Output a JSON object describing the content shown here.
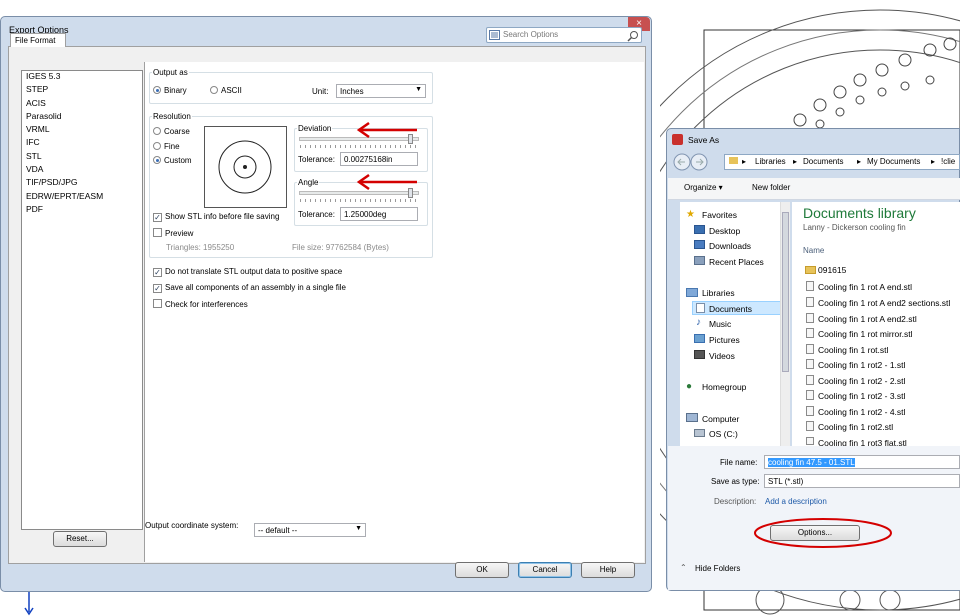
{
  "export_window": {
    "title": "Export Options",
    "close_glyph": "×",
    "tab": "File Format",
    "search_placeholder": "Search Options",
    "formats": [
      "IGES 5.3",
      "STEP",
      "ACIS",
      "Parasolid",
      "VRML",
      "IFC",
      "STL",
      "VDA",
      "TIF/PSD/JPG",
      "EDRW/EPRT/EASM",
      "PDF"
    ],
    "output_as": {
      "legend": "Output as",
      "binary": "Binary",
      "ascii": "ASCII",
      "selected": "Binary",
      "unit_label": "Unit:",
      "unit_value": "Inches"
    },
    "resolution": {
      "legend": "Resolution",
      "coarse": "Coarse",
      "fine": "Fine",
      "custom": "Custom",
      "selected": "Custom",
      "deviation_legend": "Deviation",
      "deviation_tolerance_label": "Tolerance:",
      "deviation_tolerance": "0.00275168in",
      "angle_legend": "Angle",
      "angle_tolerance_label": "Tolerance:",
      "angle_tolerance": "1.25000deg",
      "show_info": "Show STL info before file saving",
      "preview": "Preview",
      "triangles": "Triangles:  1955250",
      "file_size": "File size:  97762584 (Bytes)"
    },
    "options": [
      {
        "label": "Do not translate STL output data to positive space",
        "checked": true
      },
      {
        "label": "Save all components of an assembly in a single file",
        "checked": true
      },
      {
        "label": "Check for interferences",
        "checked": false
      }
    ],
    "coord_label": "Output coordinate system:",
    "coord_value": "-- default --",
    "reset": "Reset...",
    "ok": "OK",
    "cancel": "Cancel",
    "help": "Help"
  },
  "save_as": {
    "title": "Save As",
    "breadcrumb": [
      "Libraries",
      "Documents",
      "My Documents",
      "!clie"
    ],
    "organize": "Organize ▾",
    "new_folder": "New folder",
    "nav": {
      "favorites": "Favorites",
      "desktop": "Desktop",
      "downloads": "Downloads",
      "recent": "Recent Places",
      "libraries": "Libraries",
      "documents": "Documents",
      "music": "Music",
      "pictures": "Pictures",
      "videos": "Videos",
      "homegroup": "Homegroup",
      "computer": "Computer",
      "osc": "OS (C:)"
    },
    "library_title": "Documents library",
    "library_sub": "Lanny - Dickerson cooling fin",
    "col_name": "Name",
    "files": [
      "091615",
      "Cooling fin 1 rot A end.stl",
      "Cooling fin 1 rot A end2 sections.stl",
      "Cooling fin 1 rot A end2.stl",
      "Cooling fin 1 rot mirror.stl",
      "Cooling fin 1 rot.stl",
      "Cooling fin 1 rot2 - 1.stl",
      "Cooling fin 1 rot2 - 2.stl",
      "Cooling fin 1 rot2 - 3.stl",
      "Cooling fin 1 rot2 - 4.stl",
      "Cooling fin 1 rot2.stl",
      "Cooling fin 1 rot3 flat.stl"
    ],
    "file_name_label": "File name:",
    "file_name_value": "cooling fin 47.5 - 01.STL",
    "type_label": "Save as type:",
    "type_value": "STL (*.stl)",
    "desc_label": "Description:",
    "desc_link": "Add a description",
    "options_btn": "Options...",
    "hide_folders": "Hide Folders"
  },
  "colors": {
    "annotation_red": "#d40000",
    "accent_blue": "#1e5aa8"
  }
}
